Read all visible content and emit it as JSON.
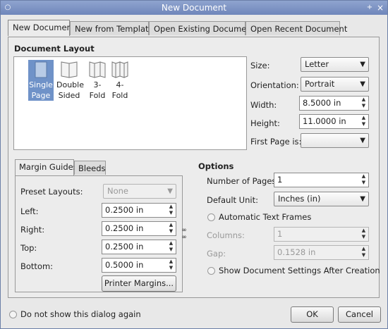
{
  "window": {
    "title": "New Document",
    "help_glyph": "+",
    "close_glyph": "×",
    "menu_glyph": "○"
  },
  "tabs": [
    "New Document",
    "New from Template",
    "Open Existing Document",
    "Open Recent Document"
  ],
  "document_layout": {
    "title": "Document Layout",
    "items": [
      {
        "line1": "Single",
        "line2": "Page"
      },
      {
        "line1": "Double",
        "line2": "Sided"
      },
      {
        "line1": "3-",
        "line2": "Fold"
      },
      {
        "line1": "4-",
        "line2": "Fold"
      }
    ],
    "size_label": "Size:",
    "size_value": "Letter",
    "orientation_label": "Orientation:",
    "orientation_value": "Portrait",
    "width_label": "Width:",
    "width_value": "8.5000 in",
    "height_label": "Height:",
    "height_value": "11.0000 in",
    "first_page_label": "First Page is:",
    "first_page_value": ""
  },
  "margin": {
    "tab_guides": "Margin Guides",
    "tab_bleeds": "Bleeds",
    "preset_label": "Preset Layouts:",
    "preset_value": "None",
    "left_label": "Left:",
    "left_value": "0.2500 in",
    "right_label": "Right:",
    "right_value": "0.2500 in",
    "top_label": "Top:",
    "top_value": "0.2500 in",
    "bottom_label": "Bottom:",
    "bottom_value": "0.5000 in",
    "printer_margins_label": "Printer Margins..."
  },
  "options": {
    "title": "Options",
    "pages_label": "Number of Pages:",
    "pages_value": "1",
    "unit_label": "Default Unit:",
    "unit_value": "Inches (in)",
    "auto_frames_label": "Automatic Text Frames",
    "columns_label": "Columns:",
    "columns_value": "1",
    "gap_label": "Gap:",
    "gap_value": "0.1528 in",
    "show_settings_label": "Show Document Settings After Creation"
  },
  "footer": {
    "dont_show_label": "Do not show this dialog again",
    "ok_label": "OK",
    "cancel_label": "Cancel"
  }
}
